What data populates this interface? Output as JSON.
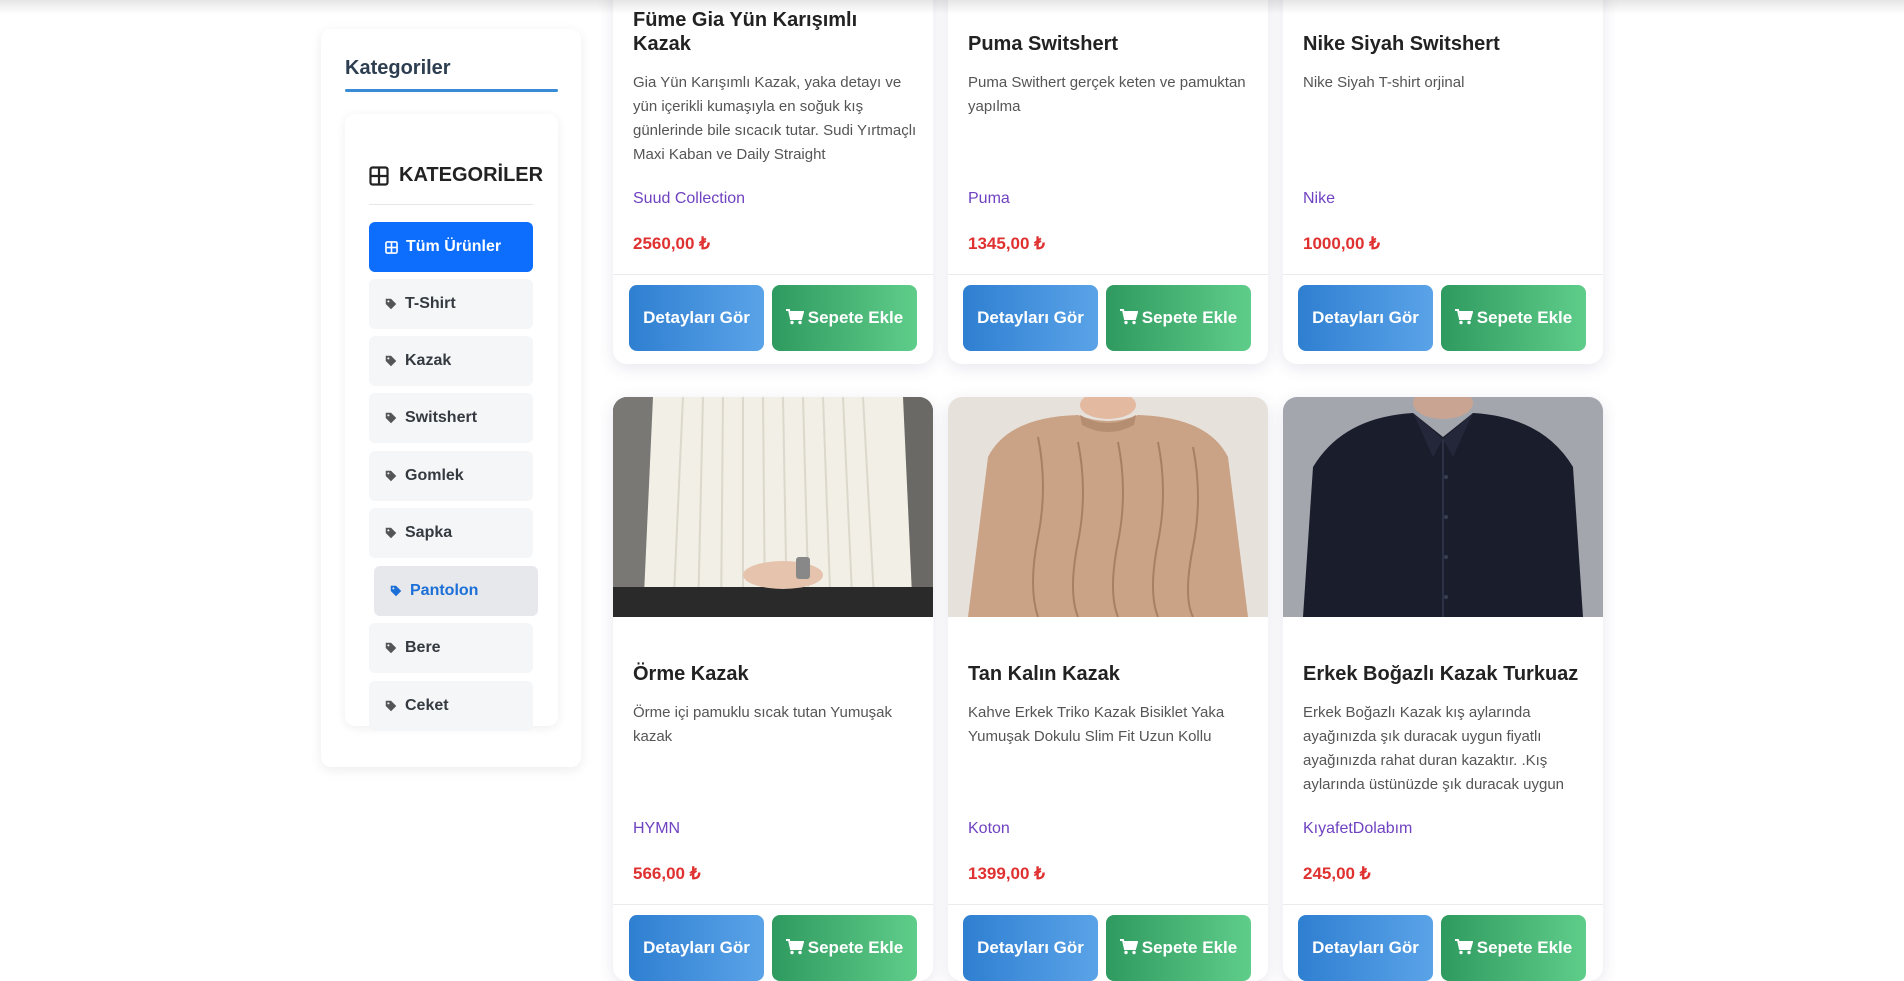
{
  "sidebar": {
    "title": "Kategoriler",
    "card_title": "KATEGORİLER",
    "items": [
      {
        "label": "Tüm Ürünler",
        "icon": "grid-icon"
      },
      {
        "label": "T-Shirt",
        "icon": "tag-icon"
      },
      {
        "label": "Kazak",
        "icon": "tag-icon"
      },
      {
        "label": "Switshert",
        "icon": "tag-icon"
      },
      {
        "label": "Gomlek",
        "icon": "tag-icon"
      },
      {
        "label": "Sapka",
        "icon": "tag-icon"
      },
      {
        "label": "Pantolon",
        "icon": "tag-icon"
      },
      {
        "label": "Bere",
        "icon": "tag-icon"
      },
      {
        "label": "Ceket",
        "icon": "tag-icon"
      }
    ],
    "active_item": "Tüm Ürünler",
    "hovered_item": "Pantolon"
  },
  "buttons": {
    "detail_label": "Detayları Gör",
    "cart_label": "Sepete Ekle"
  },
  "products": [
    {
      "title": "Füme Gia Yün Karışımlı Kazak",
      "description": "Gia Yün Karışımlı Kazak, yaka detayı ve yün içerikli kumaşıyla en soğuk kış günlerinde bile sıcacık tutar. Sudi Yırtmaçlı Maxi Kaban ve Daily Straight",
      "brand": "Suud Collection",
      "price": "2560,00 ₺"
    },
    {
      "title": "Puma Switshert",
      "description": "Puma Swithert gerçek keten ve pamuktan yapılma",
      "brand": "Puma",
      "price": "1345,00 ₺"
    },
    {
      "title": "Nike Siyah Switshert",
      "description": "Nike Siyah T-shirt orjinal",
      "brand": "Nike",
      "price": "1000,00 ₺"
    },
    {
      "title": "Örme Kazak",
      "description": "Örme içi pamuklu sıcak tutan Yumuşak kazak",
      "brand": "HYMN",
      "price": "566,00 ₺"
    },
    {
      "title": "Tan Kalın Kazak",
      "description": "Kahve Erkek Triko Kazak Bisiklet Yaka Yumuşak Dokulu Slim Fit Uzun Kollu",
      "brand": "Koton",
      "price": "1399,00 ₺"
    },
    {
      "title": "Erkek Boğazlı Kazak Turkuaz",
      "description": "Erkek Boğazlı Kazak kış aylarında ayağınızda şık duracak uygun fiyatlı ayağınızda rahat duran kazaktır. .Kış aylarında üstünüzde şık duracak uygun",
      "brand": "KıyafetDolabım",
      "price": "245,00 ₺"
    }
  ],
  "colors": {
    "accent": "#0d6efd",
    "brand_text": "#6f42c1",
    "price_text": "#e03131",
    "detail_button": "#2f7fd1",
    "cart_button": "#2f9a5f"
  }
}
